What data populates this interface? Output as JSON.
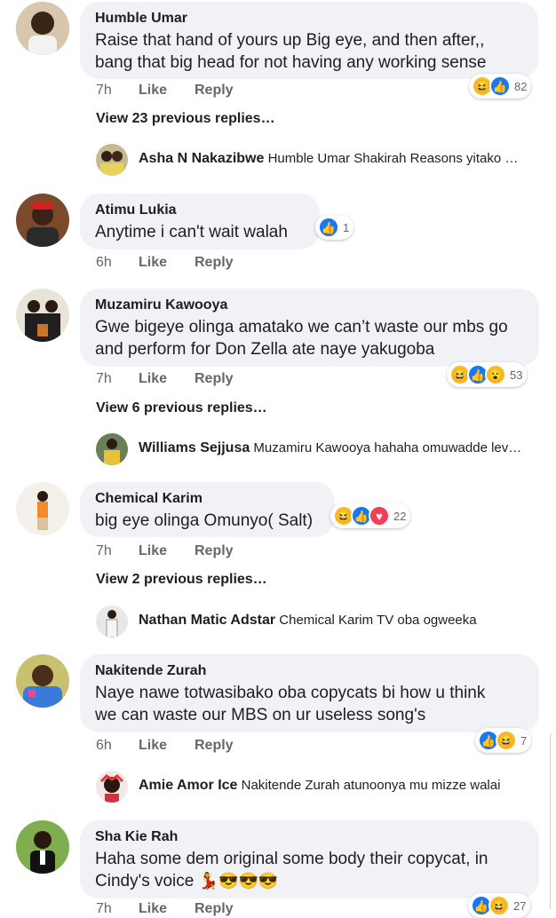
{
  "colors": {
    "bubble": "#f0f2f5",
    "meta": "#65676b",
    "like": "#1877f2",
    "haha": "#f7b928",
    "love": "#f33e58"
  },
  "action_labels": {
    "like": "Like",
    "reply": "Reply"
  },
  "comments": [
    {
      "author": "Humble Umar",
      "line1": "Raise that hand of yours up Big eye, and then after,,",
      "line2": "bang that big head for not having any working sense",
      "time": "7h",
      "reaction_count": "82",
      "reaction_icons": [
        "haha-icon",
        "like-icon"
      ],
      "view_previous": "View 23 previous replies…",
      "reply": {
        "author": "Asha N Nakazibwe",
        "text": "Humble Umar Shakirah Reasons yitako …"
      }
    },
    {
      "author": "Atimu Lukia",
      "line1": "Anytime i can't wait walah",
      "time": "6h",
      "reaction_count": "1",
      "reaction_icons": [
        "like-icon"
      ]
    },
    {
      "author": "Muzamiru Kawooya",
      "line1": "Gwe bigeye olinga amatako we can’t waste our mbs go",
      "line2": "and perform for Don Zella ate naye yakugoba",
      "time": "7h",
      "reaction_count": "53",
      "reaction_icons": [
        "haha-icon",
        "like-icon",
        "wow-icon"
      ],
      "view_previous": "View 6 previous replies…",
      "reply": {
        "author": "Williams Sejjusa",
        "text": "Muzamiru Kawooya hahaha omuwadde lev…"
      }
    },
    {
      "author": "Chemical Karim",
      "line1": "big eye olinga Omunyo( Salt)",
      "time": "7h",
      "reaction_count": "22",
      "reaction_icons": [
        "haha-icon",
        "like-icon",
        "love-icon"
      ],
      "view_previous": "View 2 previous replies…",
      "reply": {
        "author": "Nathan Matic Adstar",
        "text": "Chemical Karim TV oba ogweeka"
      }
    },
    {
      "author": "Nakitende Zurah",
      "line1": "Naye nawe totwasibako oba copycats bi how u think",
      "line2": "we can waste our MBS on ur useless song's",
      "time": "6h",
      "reaction_count": "7",
      "reaction_icons": [
        "like-icon",
        "haha-icon"
      ],
      "reply": {
        "author": "Amie Amor Ice",
        "text": "Nakitende Zurah atunoonya mu mizze walai"
      }
    },
    {
      "author": "Sha Kie Rah",
      "line1": "Haha some dem original some body their copycat,  in",
      "line2": "Cindy's voice",
      "line2_emoji": "💃😎😎😎",
      "time": "7h",
      "reaction_count": "27",
      "reaction_icons": [
        "like-icon",
        "haha-icon"
      ]
    }
  ]
}
